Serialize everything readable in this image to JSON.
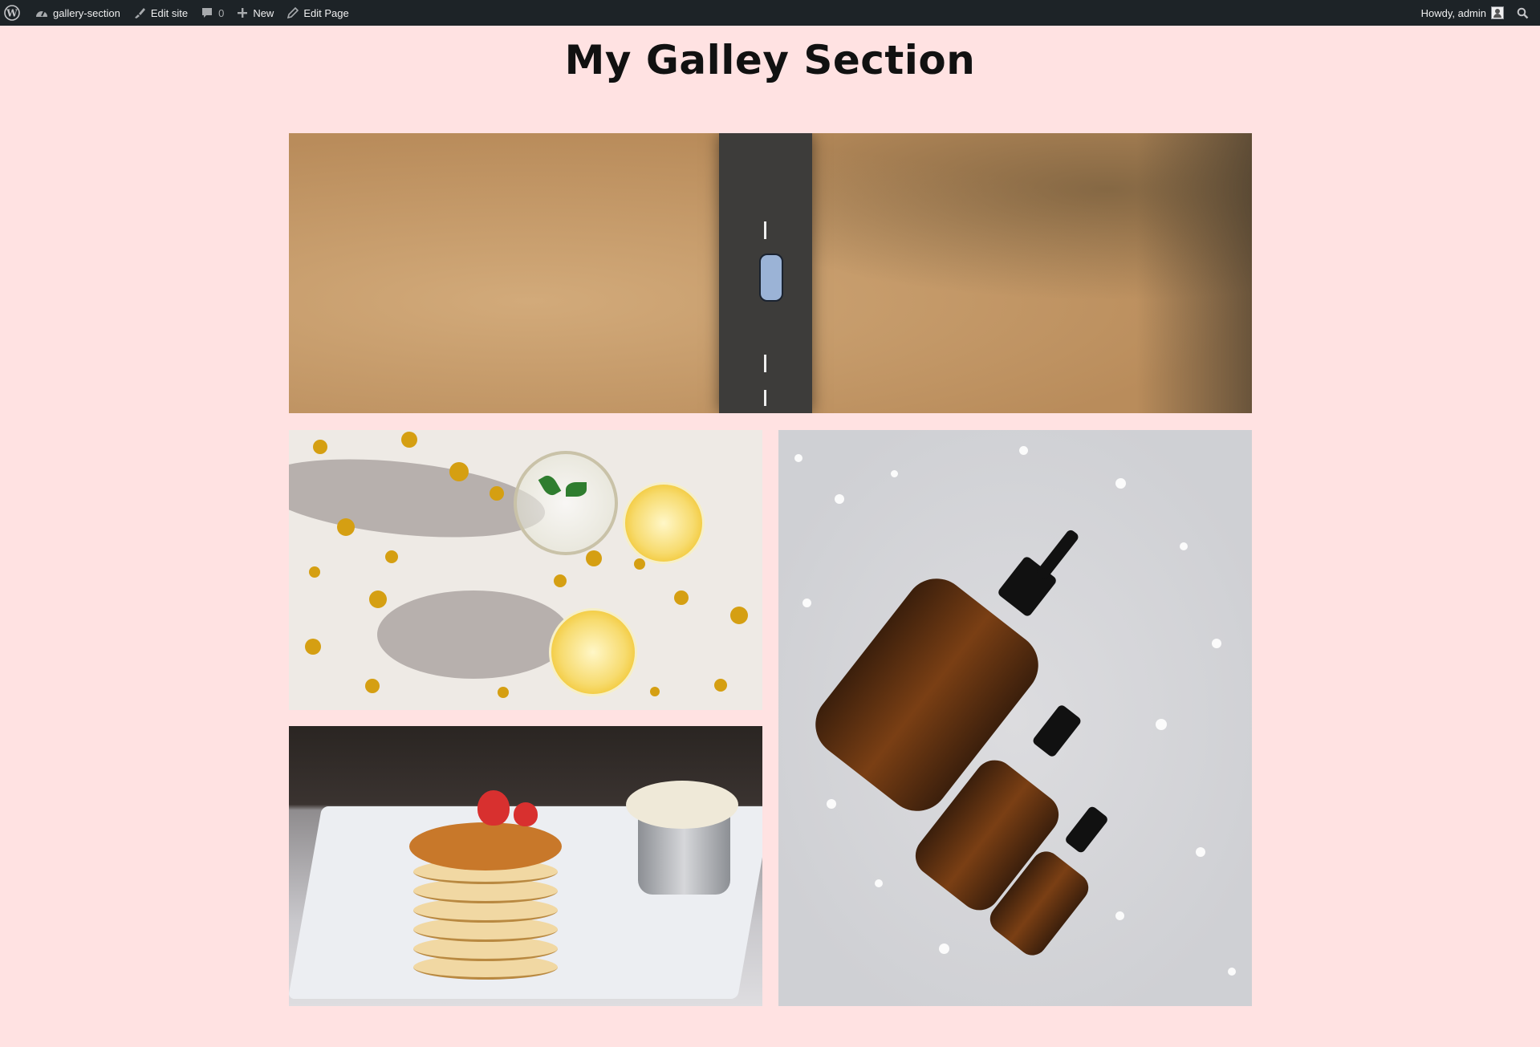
{
  "admin_bar": {
    "site_name": "gallery-section",
    "edit_site": "Edit site",
    "comments_count": "0",
    "new_label": "New",
    "edit_page": "Edit Page",
    "greeting": "Howdy, admin"
  },
  "page": {
    "title": "My Galley Section"
  },
  "gallery": {
    "images": [
      {
        "name": "desert-road-photo"
      },
      {
        "name": "lemons-photo"
      },
      {
        "name": "amber-bottles-photo"
      },
      {
        "name": "pancakes-photo"
      }
    ]
  },
  "colors": {
    "background": "#ffe2e2",
    "admin_bar": "#1d2327"
  }
}
